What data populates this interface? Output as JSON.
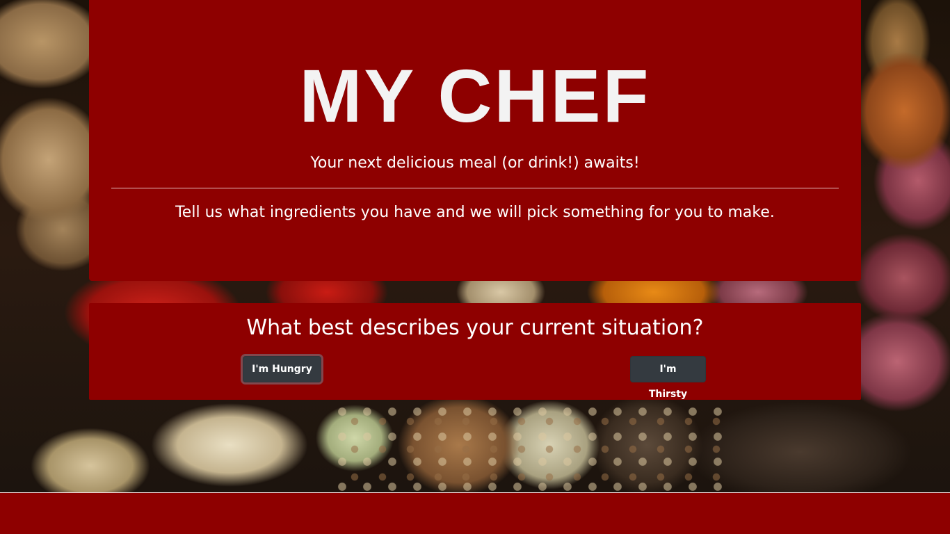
{
  "hero": {
    "title": "MY CHEF",
    "tagline": "Your next delicious meal (or drink!) awaits!",
    "instructions": "Tell us what ingredients you have and we will pick something for you to make."
  },
  "question": {
    "text": "What best describes your current situation?",
    "buttons": [
      {
        "label": "I'm Hungry"
      },
      {
        "label": "I'm Thirsty"
      }
    ]
  },
  "theme": {
    "panel_color": "#8e0000",
    "button_color": "#343a40",
    "text_color": "#ffffff"
  },
  "background": {
    "subject": "spices-and-vegetables-photo"
  }
}
